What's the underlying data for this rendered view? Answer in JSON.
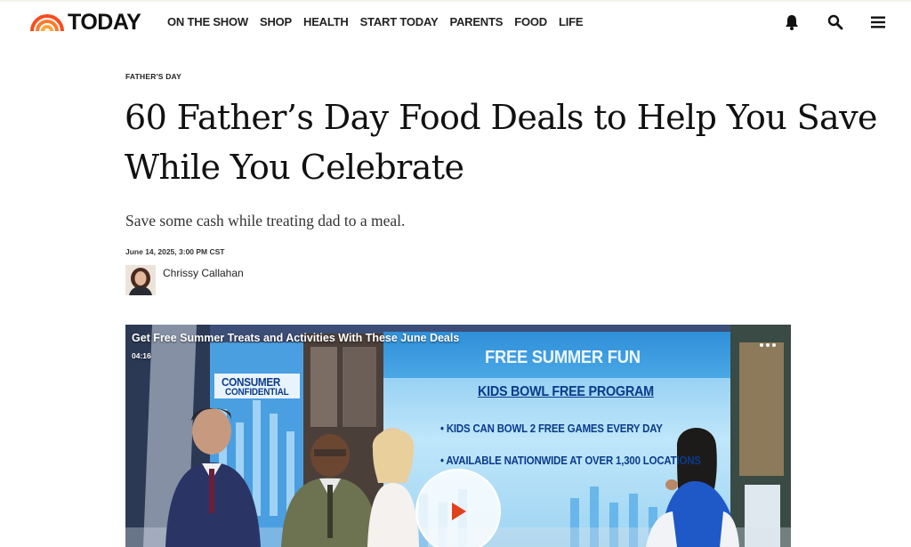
{
  "brand": {
    "logo_text": "TODAY",
    "accent_color": "#ff5a1f"
  },
  "nav": {
    "items": [
      "ON THE SHOW",
      "SHOP",
      "HEALTH",
      "START TODAY",
      "PARENTS",
      "FOOD",
      "LIFE"
    ]
  },
  "header_icons": [
    "bell-icon",
    "search-icon",
    "menu-icon"
  ],
  "article": {
    "kicker": "FATHER'S DAY",
    "headline": "60 Father’s Day Food Deals to Help You Save While You Celebrate",
    "dek": "Save some cash while treating dad to a meal.",
    "timestamp": "June 14, 2025, 3:00 PM CST",
    "author": "Chrissy Callahan"
  },
  "video": {
    "title": "Get Free Summer Treats and Activities With These June Deals",
    "duration": "04:16",
    "screen": {
      "heading": "FREE SUMMER FUN",
      "program": "KIDS BOWL FREE PROGRAM",
      "bullet_1": "• KIDS CAN BOWL 2 FREE GAMES EVERY DAY",
      "bullet_2": "• AVAILABLE NATIONWIDE AT OVER 1,300 LOCATIONS",
      "segment_line1": "CONSUMER",
      "segment_line2": "CONFIDENTIAL"
    }
  }
}
